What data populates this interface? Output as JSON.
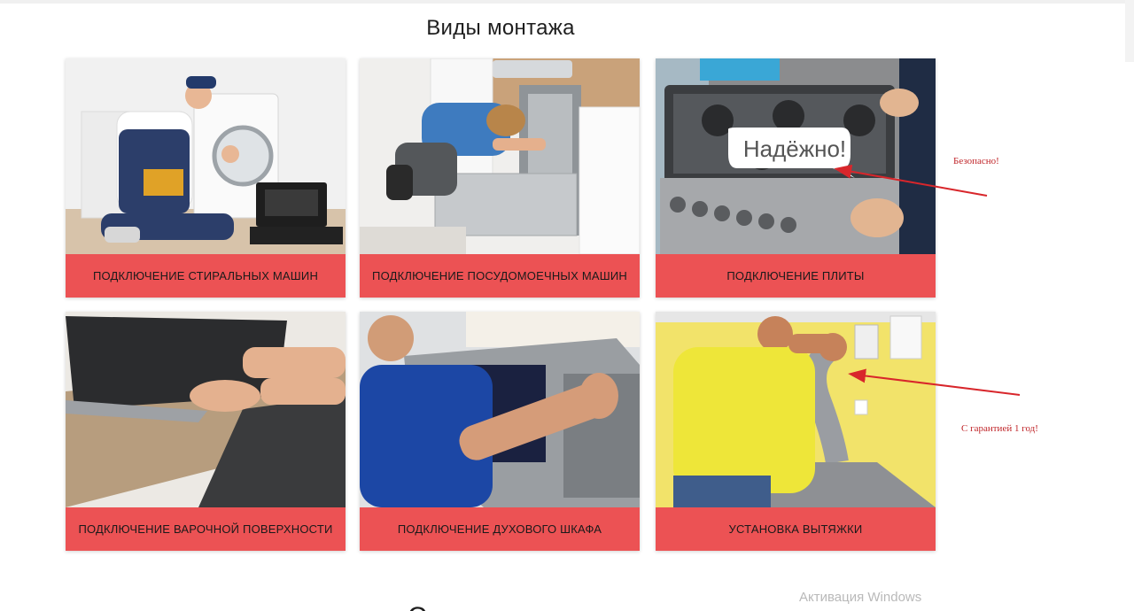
{
  "section": {
    "title": "Виды монтажа"
  },
  "cards": [
    {
      "label": "ПОДКЛЮЧЕНИЕ СТИРАЛЬНЫХ МАШИН"
    },
    {
      "label": "ПОДКЛЮЧЕНИЕ ПОСУДОМОЕЧНЫХ МАШИН"
    },
    {
      "label": "ПОДКЛЮЧЕНИЕ ПЛИТЫ",
      "bubble": "Надёжно!"
    },
    {
      "label": "ПОДКЛЮЧЕНИЕ ВАРОЧНОЙ ПОВЕРХНОСТИ"
    },
    {
      "label": "ПОДКЛЮЧЕНИЕ ДУХОВОГО ШКАФА"
    },
    {
      "label": "УСТАНОВКА ВЫТЯЖКИ"
    }
  ],
  "annotations": {
    "safe": "Безопасно!",
    "warranty": "С гарантией 1 год!"
  },
  "watermark": "Активация Windows",
  "colors": {
    "caption_bg": "#ec5254",
    "annotation": "#c0262a"
  }
}
